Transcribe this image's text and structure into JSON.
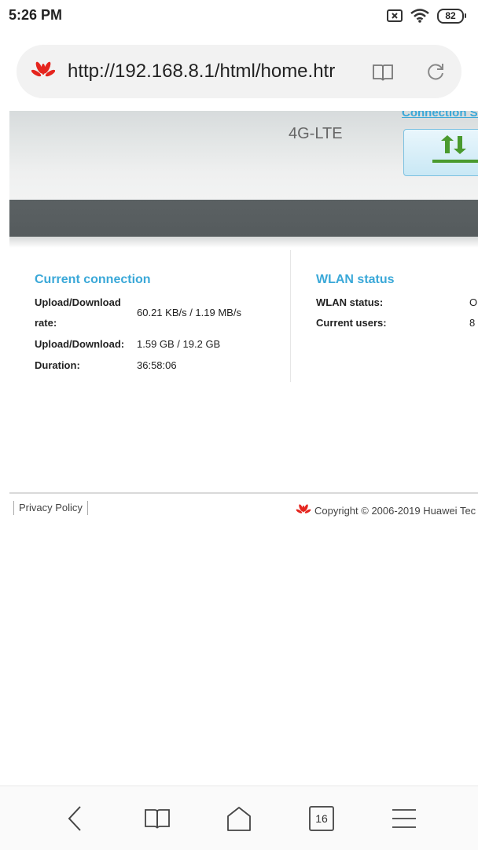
{
  "status_bar": {
    "time": "5:26 PM",
    "battery": "82"
  },
  "browser": {
    "url": "http://192.168.8.1/html/home.htr",
    "tabs_count": "16"
  },
  "banner": {
    "network_type": "4G-LTE",
    "connection_link": "Connection Se"
  },
  "current_connection": {
    "title": "Current connection",
    "rows": [
      {
        "label_line1": "Upload/Download",
        "label_line2": "rate:",
        "value": "60.21 KB/s / 1.19 MB/s"
      },
      {
        "label": "Upload/Download:",
        "value": "1.59 GB / 19.2 GB"
      },
      {
        "label": "Duration:",
        "value": "36:58:06"
      }
    ]
  },
  "wlan": {
    "title": "WLAN status",
    "rows": [
      {
        "label": "WLAN status:",
        "value": "On"
      },
      {
        "label": "Current users:",
        "value": "8"
      }
    ]
  },
  "footer": {
    "privacy": "Privacy Policy",
    "copyright": "Copyright © 2006-2019 Huawei Tec"
  },
  "colors": {
    "accent": "#3aa8d8",
    "huawei_red": "#e5251e",
    "band": "#5b6163"
  }
}
